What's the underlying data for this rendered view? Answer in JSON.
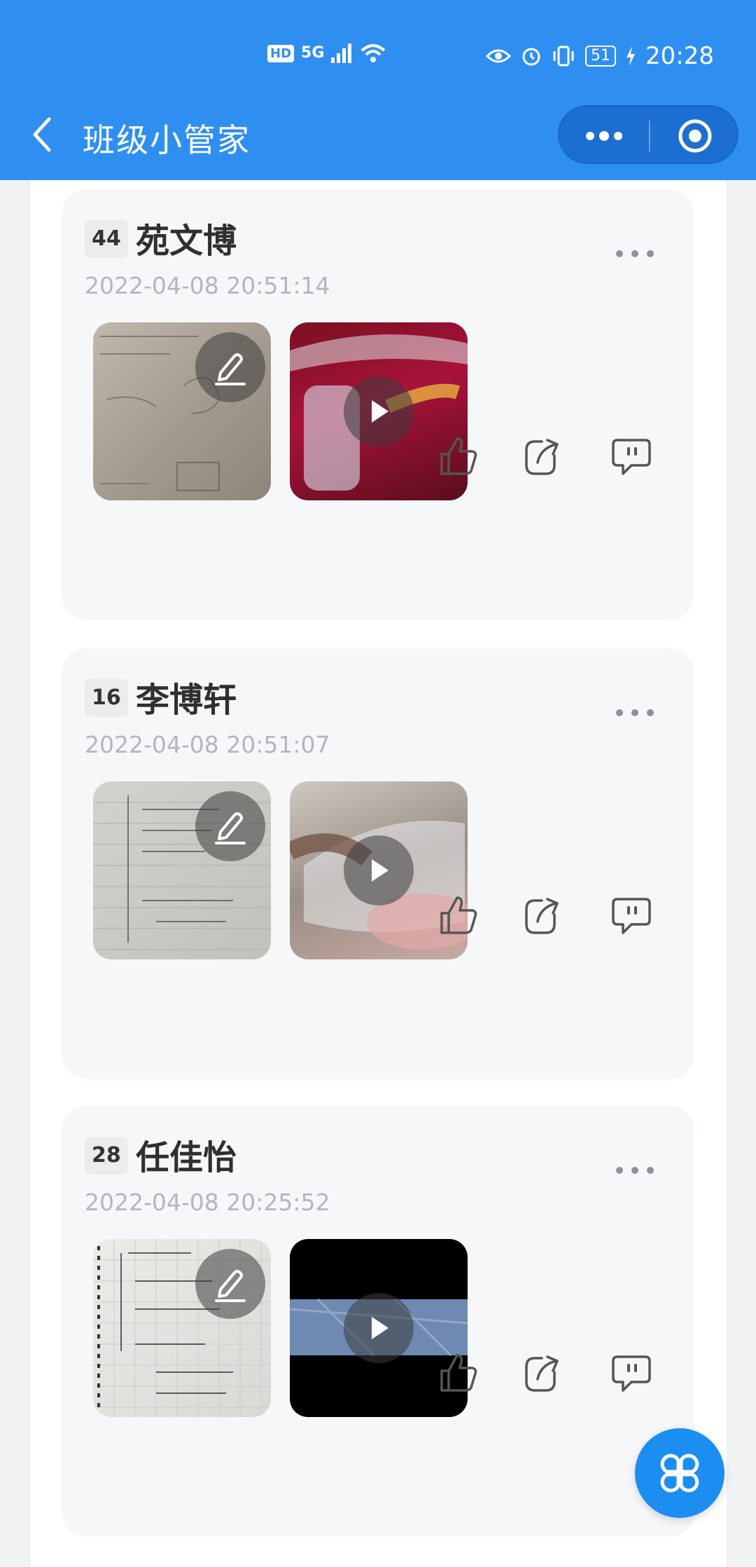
{
  "status_bar": {
    "hd": "HD",
    "network": "5G",
    "battery": "51",
    "time": "20:28"
  },
  "header": {
    "title": "班级小管家"
  },
  "posts": [
    {
      "number": "44",
      "name": "苑文博",
      "timestamp": "2022-04-08 20:51:14",
      "media": [
        {
          "kind": "image",
          "overlay_icon": "pencil-icon"
        },
        {
          "kind": "video",
          "overlay_icon": "play-icon"
        }
      ]
    },
    {
      "number": "16",
      "name": "李博轩",
      "timestamp": "2022-04-08 20:51:07",
      "media": [
        {
          "kind": "image",
          "overlay_icon": "pencil-icon"
        },
        {
          "kind": "video",
          "overlay_icon": "play-icon"
        }
      ]
    },
    {
      "number": "28",
      "name": "任佳怡",
      "timestamp": "2022-04-08 20:25:52",
      "media": [
        {
          "kind": "image",
          "overlay_icon": "pencil-icon"
        },
        {
          "kind": "video",
          "overlay_icon": "play-icon"
        }
      ]
    }
  ],
  "colors": {
    "brand": "#2f8ff0",
    "card_bg": "#f6f7f9",
    "fab": "#1c8ef2"
  }
}
